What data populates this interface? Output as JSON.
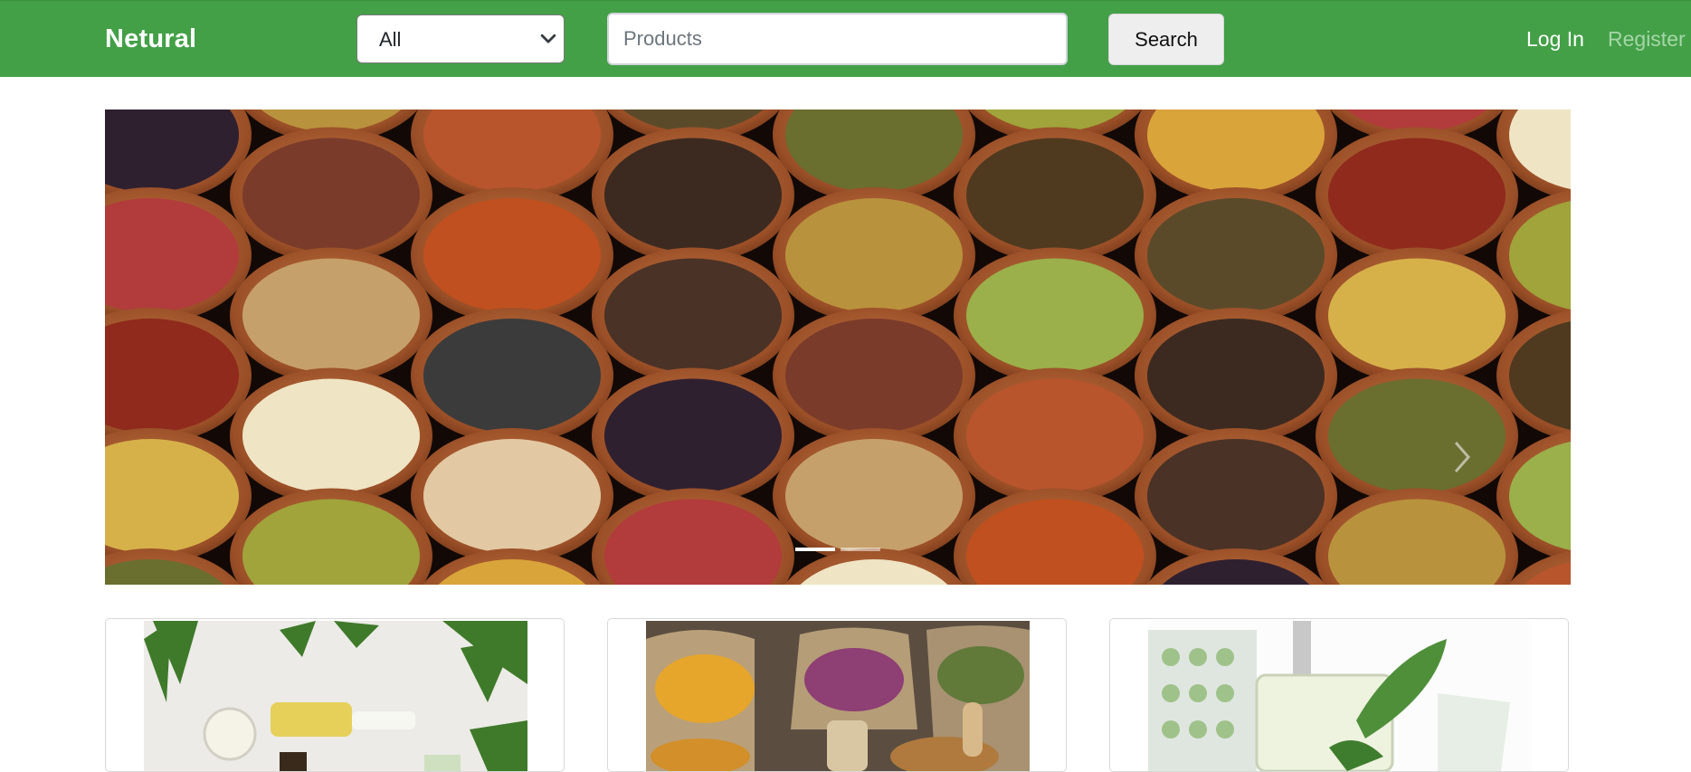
{
  "navbar": {
    "brand": "Netural",
    "category_select": {
      "selected": "All"
    },
    "search": {
      "placeholder": "Products",
      "value": ""
    },
    "search_button": "Search",
    "login": "Log In",
    "register": "Register"
  },
  "carousel": {
    "image": "spice-bowls-photo",
    "slide_count": 2,
    "active_slide": 1,
    "next_icon": "chevron-right-icon"
  },
  "cards": [
    {
      "image": "natural-cosmetics-photo"
    },
    {
      "image": "dried-herbs-photo"
    },
    {
      "image": "herbal-medicine-photo"
    }
  ],
  "colors": {
    "navbar": "#43a047",
    "brand_text": "#ffffff",
    "register_text": "#a6d6a8"
  }
}
